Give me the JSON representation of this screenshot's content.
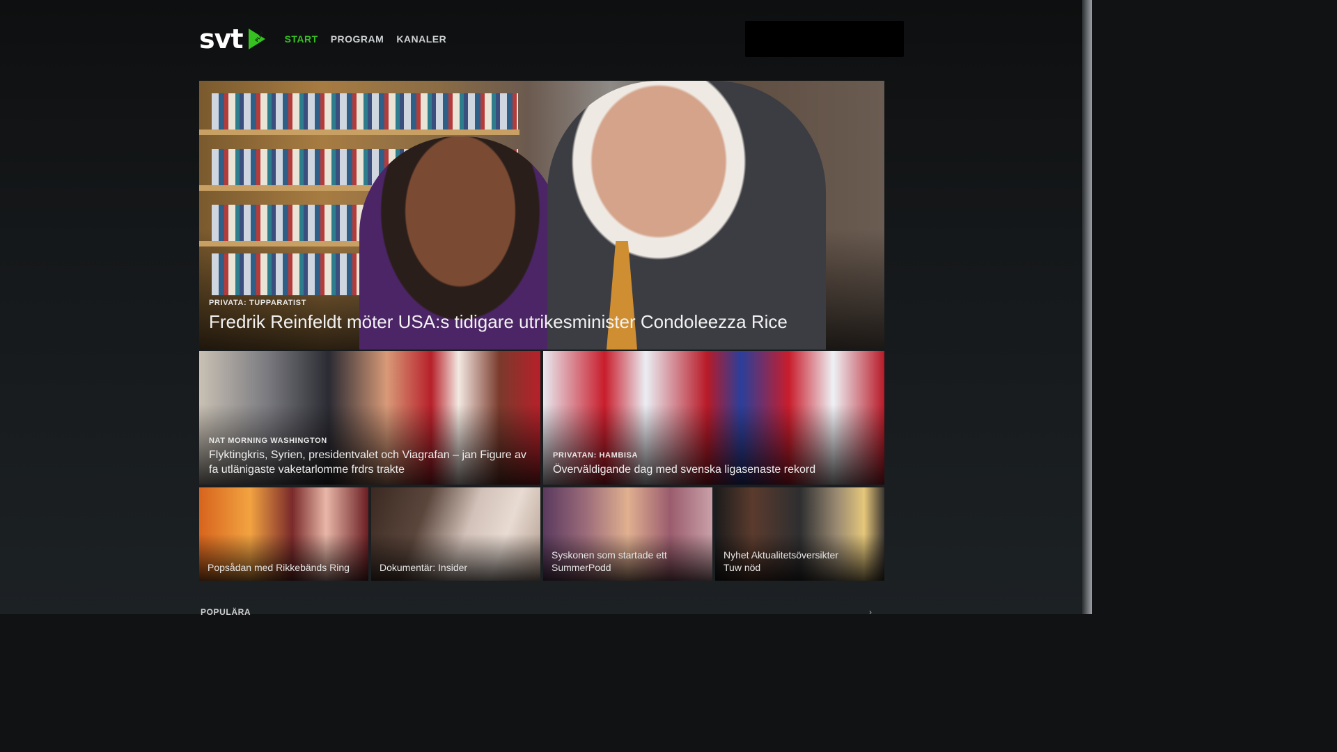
{
  "brand": {
    "logo_text": "svt",
    "logo_badge": "PLAY",
    "accent": "#35c11f"
  },
  "nav": {
    "items": [
      {
        "label": "START",
        "active": true
      },
      {
        "label": "PROGRAM",
        "active": false
      },
      {
        "label": "KANALER",
        "active": false
      }
    ]
  },
  "hero": {
    "kicker": "PRIVATA: TUPPARATIST",
    "title": "Fredrik Reinfeldt möter USA:s tidigare utrikesminister Condoleezza Rice"
  },
  "featured": [
    {
      "kicker": "NAT MORNING WASHINGTON",
      "title": "Flyktingkris, Syrien, presidentvalet och Viagrafan – jan Figure av fa utlänigaste vaketarlomme frdrs trakte"
    },
    {
      "kicker": "PRIVATAN: HAMBISA",
      "title": "Överväldigande dag med svenska ligasenaste rekord"
    }
  ],
  "grid": [
    {
      "title": "Popsådan med Rikkebänds Ring",
      "subtitle": ""
    },
    {
      "title": "Dokumentär: Insider",
      "subtitle": ""
    },
    {
      "title": "Syskonen som startade ett SummerPodd",
      "subtitle": ""
    },
    {
      "title": "Nyhet Aktualitetsöversikter",
      "subtitle": "Tuw nöd"
    }
  ],
  "section": {
    "label": "POPULÄRA",
    "arrow": "›"
  }
}
